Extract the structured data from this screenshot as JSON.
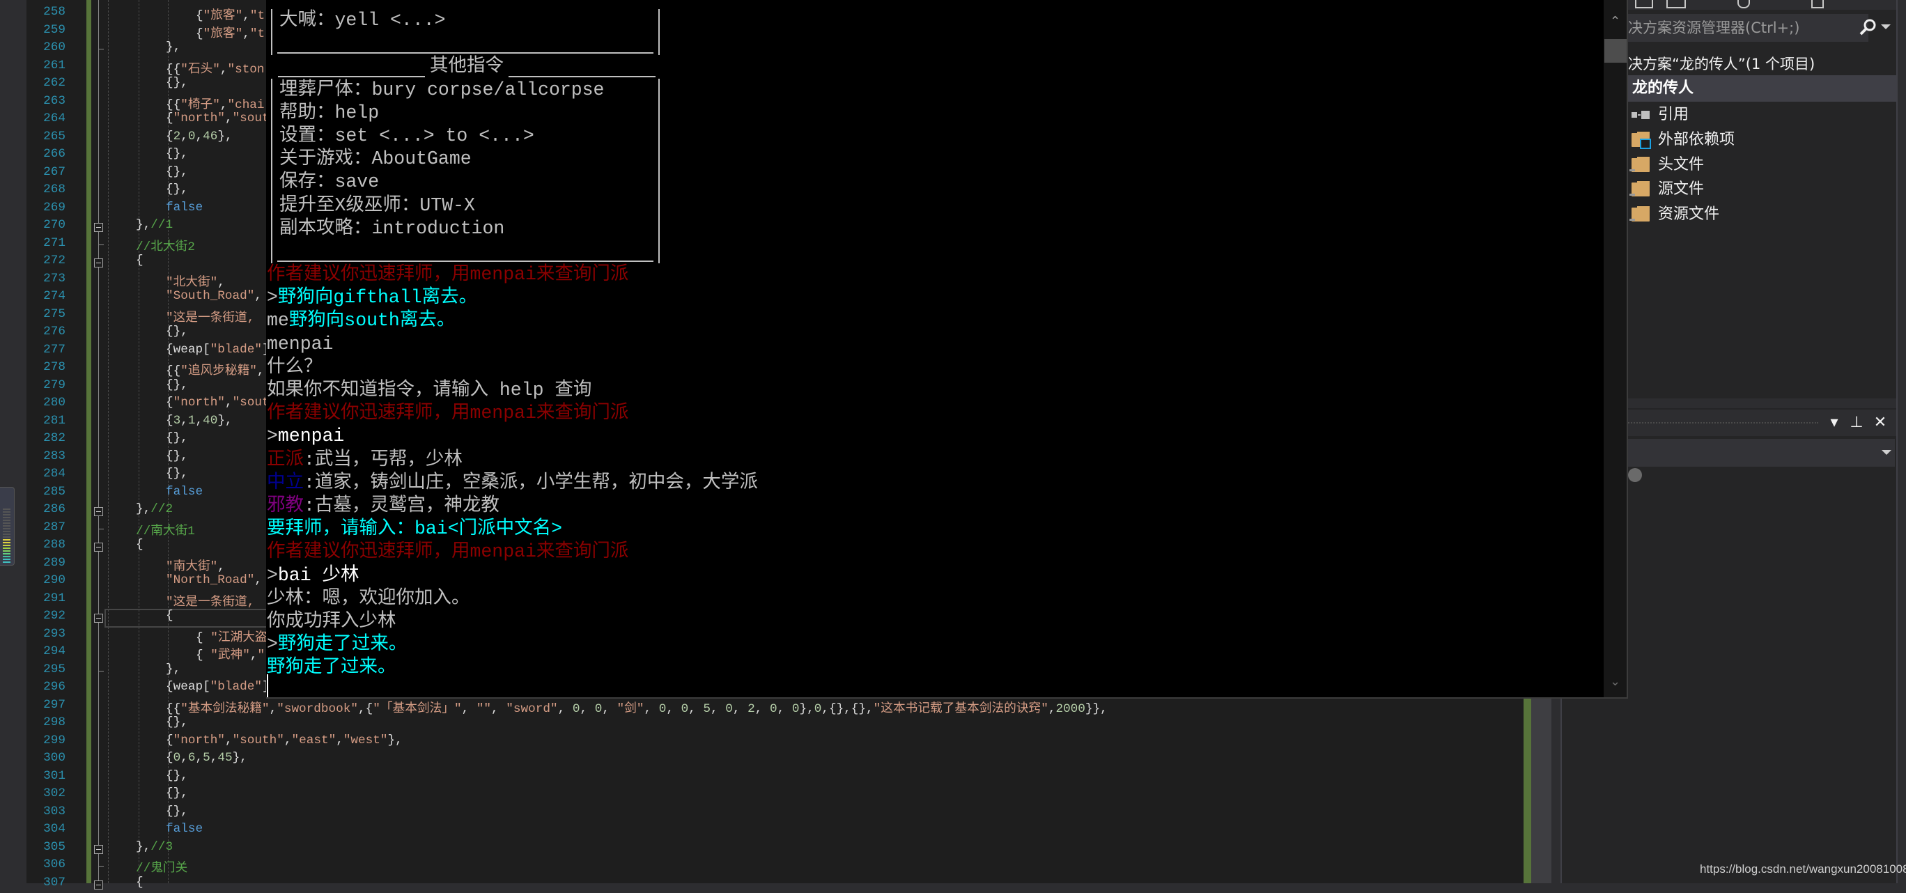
{
  "editor": {
    "lines": [
      {
        "n": "258",
        "indent": 3,
        "t": [
          [
            "p",
            "{"
          ],
          [
            "s",
            "\"旅客\""
          ],
          [
            "p",
            ","
          ],
          [
            "s",
            "\"t"
          ]
        ]
      },
      {
        "n": "259",
        "indent": 3,
        "t": [
          [
            "p",
            "{"
          ],
          [
            "s",
            "\"旅客\""
          ],
          [
            "p",
            ","
          ],
          [
            "s",
            "\"t"
          ]
        ]
      },
      {
        "n": "260",
        "indent": 2,
        "t": [
          [
            "p",
            "},"
          ]
        ]
      },
      {
        "n": "261",
        "indent": 2,
        "t": [
          [
            "p",
            "{{"
          ],
          [
            "s",
            "\"石头\""
          ],
          [
            "p",
            ","
          ],
          [
            "s",
            "\"ston"
          ]
        ]
      },
      {
        "n": "262",
        "indent": 2,
        "t": [
          [
            "p",
            "{},"
          ]
        ]
      },
      {
        "n": "263",
        "indent": 2,
        "t": [
          [
            "p",
            "{{"
          ],
          [
            "s",
            "\"椅子\""
          ],
          [
            "p",
            ","
          ],
          [
            "s",
            "\"chai"
          ]
        ]
      },
      {
        "n": "264",
        "indent": 2,
        "t": [
          [
            "p",
            "{"
          ],
          [
            "s",
            "\"north\""
          ],
          [
            "p",
            ","
          ],
          [
            "s",
            "\"sout"
          ]
        ]
      },
      {
        "n": "265",
        "indent": 2,
        "t": [
          [
            "p",
            "{"
          ],
          [
            "n",
            "2"
          ],
          [
            "p",
            ","
          ],
          [
            "n",
            "0"
          ],
          [
            "p",
            ","
          ],
          [
            "n",
            "46"
          ],
          [
            "p",
            "},"
          ]
        ]
      },
      {
        "n": "266",
        "indent": 2,
        "t": [
          [
            "p",
            "{},"
          ]
        ]
      },
      {
        "n": "267",
        "indent": 2,
        "t": [
          [
            "p",
            "{},"
          ]
        ]
      },
      {
        "n": "268",
        "indent": 2,
        "t": [
          [
            "p",
            "{},"
          ]
        ]
      },
      {
        "n": "269",
        "indent": 2,
        "t": [
          [
            "k",
            "false"
          ]
        ]
      },
      {
        "n": "270",
        "indent": 1,
        "fold": true,
        "t": [
          [
            "p",
            "},"
          ],
          [
            "c",
            "//1"
          ]
        ]
      },
      {
        "n": "271",
        "indent": 1,
        "t": [
          [
            "c",
            "//北大街2"
          ]
        ]
      },
      {
        "n": "272",
        "indent": 1,
        "fold": true,
        "t": [
          [
            "p",
            "{"
          ]
        ]
      },
      {
        "n": "273",
        "indent": 2,
        "t": [
          [
            "s",
            "\"北大街\""
          ],
          [
            "p",
            ","
          ]
        ]
      },
      {
        "n": "274",
        "indent": 2,
        "t": [
          [
            "s",
            "\"South_Road\""
          ],
          [
            "p",
            ","
          ]
        ]
      },
      {
        "n": "275",
        "indent": 2,
        "t": [
          [
            "s",
            "\"这是一条街道,"
          ]
        ]
      },
      {
        "n": "276",
        "indent": 2,
        "t": [
          [
            "p",
            "{},"
          ]
        ]
      },
      {
        "n": "277",
        "indent": 2,
        "t": [
          [
            "p",
            "{weap["
          ],
          [
            "s",
            "\"blade\""
          ],
          [
            "p",
            "]"
          ]
        ]
      },
      {
        "n": "278",
        "indent": 2,
        "t": [
          [
            "p",
            "{{"
          ],
          [
            "s",
            "\"追风步秘籍\""
          ],
          [
            "p",
            ","
          ]
        ]
      },
      {
        "n": "279",
        "indent": 2,
        "t": [
          [
            "p",
            "{},"
          ]
        ]
      },
      {
        "n": "280",
        "indent": 2,
        "t": [
          [
            "p",
            "{"
          ],
          [
            "s",
            "\"north\""
          ],
          [
            "p",
            ","
          ],
          [
            "s",
            "\"sout"
          ]
        ]
      },
      {
        "n": "281",
        "indent": 2,
        "t": [
          [
            "p",
            "{"
          ],
          [
            "n",
            "3"
          ],
          [
            "p",
            ","
          ],
          [
            "n",
            "1"
          ],
          [
            "p",
            ","
          ],
          [
            "n",
            "40"
          ],
          [
            "p",
            "},"
          ]
        ]
      },
      {
        "n": "282",
        "indent": 2,
        "t": [
          [
            "p",
            "{},"
          ]
        ]
      },
      {
        "n": "283",
        "indent": 2,
        "t": [
          [
            "p",
            "{},"
          ]
        ]
      },
      {
        "n": "284",
        "indent": 2,
        "t": [
          [
            "p",
            "{},"
          ]
        ]
      },
      {
        "n": "285",
        "indent": 2,
        "t": [
          [
            "k",
            "false"
          ]
        ]
      },
      {
        "n": "286",
        "indent": 1,
        "fold": true,
        "t": [
          [
            "p",
            "},"
          ],
          [
            "c",
            "//2"
          ]
        ]
      },
      {
        "n": "287",
        "indent": 1,
        "t": [
          [
            "c",
            "//南大街1"
          ]
        ]
      },
      {
        "n": "288",
        "indent": 1,
        "fold": true,
        "t": [
          [
            "p",
            "{"
          ]
        ]
      },
      {
        "n": "289",
        "indent": 2,
        "t": [
          [
            "s",
            "\"南大街\""
          ],
          [
            "p",
            ","
          ]
        ]
      },
      {
        "n": "290",
        "indent": 2,
        "t": [
          [
            "s",
            "\"North_Road\""
          ],
          [
            "p",
            ","
          ]
        ]
      },
      {
        "n": "291",
        "indent": 2,
        "t": [
          [
            "s",
            "\"这是一条街道,"
          ]
        ]
      },
      {
        "n": "292",
        "indent": 2,
        "fold": true,
        "current": true,
        "t": [
          [
            "p",
            "{"
          ]
        ]
      },
      {
        "n": "293",
        "indent": 3,
        "t": [
          [
            "p",
            "{ "
          ],
          [
            "s",
            "\"江湖大盗"
          ]
        ]
      },
      {
        "n": "294",
        "indent": 3,
        "t": [
          [
            "p",
            "{ "
          ],
          [
            "s",
            "\"武神\""
          ],
          [
            "p",
            ","
          ],
          [
            "s",
            "\""
          ]
        ]
      },
      {
        "n": "295",
        "indent": 2,
        "t": [
          [
            "p",
            "},"
          ]
        ]
      },
      {
        "n": "296",
        "indent": 2,
        "t": [
          [
            "p",
            "{weap["
          ],
          [
            "s",
            "\"blade\""
          ],
          [
            "p",
            "]"
          ]
        ]
      },
      {
        "n": "297",
        "indent": 2,
        "t": [
          [
            "p",
            "{{"
          ],
          [
            "s",
            "\"基本剑法秘籍\""
          ],
          [
            "p",
            ","
          ],
          [
            "s",
            "\"swordbook\""
          ],
          [
            "p",
            ",{"
          ],
          [
            "s",
            "\"「基本剑法」\""
          ],
          [
            "p",
            ", "
          ],
          [
            "s",
            "\"\""
          ],
          [
            "p",
            ", "
          ],
          [
            "s",
            "\"sword\""
          ],
          [
            "p",
            ", "
          ],
          [
            "n",
            "0"
          ],
          [
            "p",
            ", "
          ],
          [
            "n",
            "0"
          ],
          [
            "p",
            ", "
          ],
          [
            "s",
            "\"剑\""
          ],
          [
            "p",
            ", "
          ],
          [
            "n",
            "0"
          ],
          [
            "p",
            ", "
          ],
          [
            "n",
            "0"
          ],
          [
            "p",
            ", "
          ],
          [
            "n",
            "5"
          ],
          [
            "p",
            ", "
          ],
          [
            "n",
            "0"
          ],
          [
            "p",
            ", "
          ],
          [
            "n",
            "2"
          ],
          [
            "p",
            ", "
          ],
          [
            "n",
            "0"
          ],
          [
            "p",
            ", "
          ],
          [
            "n",
            "0"
          ],
          [
            "p",
            "},"
          ],
          [
            "n",
            "0"
          ],
          [
            "p",
            ",{},{},"
          ],
          [
            "s",
            "\"这本书记载了基本剑法的诀窍\""
          ],
          [
            "p",
            ","
          ],
          [
            "n",
            "2000"
          ],
          [
            "p",
            "}},"
          ]
        ]
      },
      {
        "n": "298",
        "indent": 2,
        "t": [
          [
            "p",
            "{},"
          ]
        ]
      },
      {
        "n": "299",
        "indent": 2,
        "t": [
          [
            "p",
            "{"
          ],
          [
            "s",
            "\"north\""
          ],
          [
            "p",
            ","
          ],
          [
            "s",
            "\"south\""
          ],
          [
            "p",
            ","
          ],
          [
            "s",
            "\"east\""
          ],
          [
            "p",
            ","
          ],
          [
            "s",
            "\"west\""
          ],
          [
            "p",
            "},"
          ]
        ]
      },
      {
        "n": "300",
        "indent": 2,
        "t": [
          [
            "p",
            "{"
          ],
          [
            "n",
            "0"
          ],
          [
            "p",
            ","
          ],
          [
            "n",
            "6"
          ],
          [
            "p",
            ","
          ],
          [
            "n",
            "5"
          ],
          [
            "p",
            ","
          ],
          [
            "n",
            "45"
          ],
          [
            "p",
            "},"
          ]
        ]
      },
      {
        "n": "301",
        "indent": 2,
        "t": [
          [
            "p",
            "{},"
          ]
        ]
      },
      {
        "n": "302",
        "indent": 2,
        "t": [
          [
            "p",
            "{},"
          ]
        ]
      },
      {
        "n": "303",
        "indent": 2,
        "t": [
          [
            "p",
            "{},"
          ]
        ]
      },
      {
        "n": "304",
        "indent": 2,
        "t": [
          [
            "k",
            "false"
          ]
        ]
      },
      {
        "n": "305",
        "indent": 1,
        "fold": true,
        "t": [
          [
            "p",
            "},"
          ],
          [
            "c",
            "//3"
          ]
        ]
      },
      {
        "n": "306",
        "indent": 1,
        "t": [
          [
            "c",
            "//鬼门关"
          ]
        ]
      },
      {
        "n": "307",
        "indent": 1,
        "fold": true,
        "t": [
          [
            "p",
            "{"
          ]
        ]
      }
    ],
    "colors": {
      "string": "#d69d85",
      "number": "#b5cea8",
      "keyword": "#569cd6",
      "comment": "#57a64a",
      "line_number": "#2b91af",
      "change_bar": "#57743a"
    }
  },
  "console": {
    "box_top_rows": [
      "大喊：yell <...>",
      ""
    ],
    "box_title": "其他指令",
    "box_rows": [
      "埋葬尸体：bury corpse/allcorpse",
      "帮助：help",
      "设置：set <...> to <...>",
      "关于游戏：AboutGame",
      "保存：save",
      "提升至X级巫师：UTW-X",
      "副本攻略：introduction",
      ""
    ],
    "log": [
      [
        [
          "r",
          "作者建议你迅速拜师，用menpai来查询门派"
        ]
      ],
      [
        [
          "g",
          ">"
        ],
        [
          "c",
          "野狗向gifthall离去。"
        ]
      ],
      [
        [
          "g",
          "me"
        ],
        [
          "c",
          "野狗向south离去。"
        ]
      ],
      [
        [
          "g",
          "menpai"
        ]
      ],
      [
        [
          "g",
          "什么？"
        ]
      ],
      [
        [
          "g",
          "如果你不知道指令，请输入 help 查询"
        ]
      ],
      [
        [
          "r",
          "作者建议你迅速拜师，用menpai来查询门派"
        ]
      ],
      [
        [
          "g",
          ">"
        ],
        [
          "w",
          "menpai"
        ]
      ],
      [
        [
          "r",
          "正派"
        ],
        [
          "g",
          ":武当，丐帮，少林"
        ]
      ],
      [
        [
          "b",
          "中立"
        ],
        [
          "g",
          ":道家，铸剑山庄，空桑派，小学生帮，初中会，大学派"
        ]
      ],
      [
        [
          "m",
          "邪教"
        ],
        [
          "g",
          ":古墓，灵鹫宫，神龙教"
        ]
      ],
      [
        [
          "c",
          "要拜师，请输入：bai<门派中文名>"
        ]
      ],
      [
        [
          "r",
          "作者建议你迅速拜师，用menpai来查询门派"
        ]
      ],
      [
        [
          "g",
          ">"
        ],
        [
          "w",
          "bai 少林"
        ]
      ],
      [
        [
          "g",
          "少林：嗯，欢迎你加入。"
        ]
      ],
      [
        [
          "g",
          "你成功拜入少林"
        ]
      ],
      [
        [
          "g",
          ">"
        ],
        [
          "c",
          "野狗走了过来。"
        ]
      ],
      [
        [
          "c",
          "野狗走了过来。"
        ]
      ]
    ],
    "colors": {
      "gray": "#c0c0c0",
      "white": "#ffffff",
      "cyan": "#00ffff",
      "red": "#8b0000",
      "blue": "#000090",
      "purple": "#800080"
    }
  },
  "solution_explorer": {
    "search_placeholder": "决方案资源管理器(Ctrl+;)",
    "solution_label": "决方案“龙的传人”(1 个项目)",
    "project_label": "龙的传人",
    "items": [
      {
        "label": "引用",
        "icon": "references-icon"
      },
      {
        "label": "外部依赖项",
        "icon": "external-dependencies-folder-icon"
      },
      {
        "label": "头文件",
        "icon": "filter-folder-icon"
      },
      {
        "label": "源文件",
        "icon": "filter-folder-icon"
      },
      {
        "label": "资源文件",
        "icon": "filter-folder-icon"
      }
    ]
  },
  "properties_panel": {
    "menu_glyph": "▾",
    "pin_glyph": "⊥",
    "close_glyph": "✕"
  },
  "watermark": "https://blog.csdn.net/wangxun20081008"
}
